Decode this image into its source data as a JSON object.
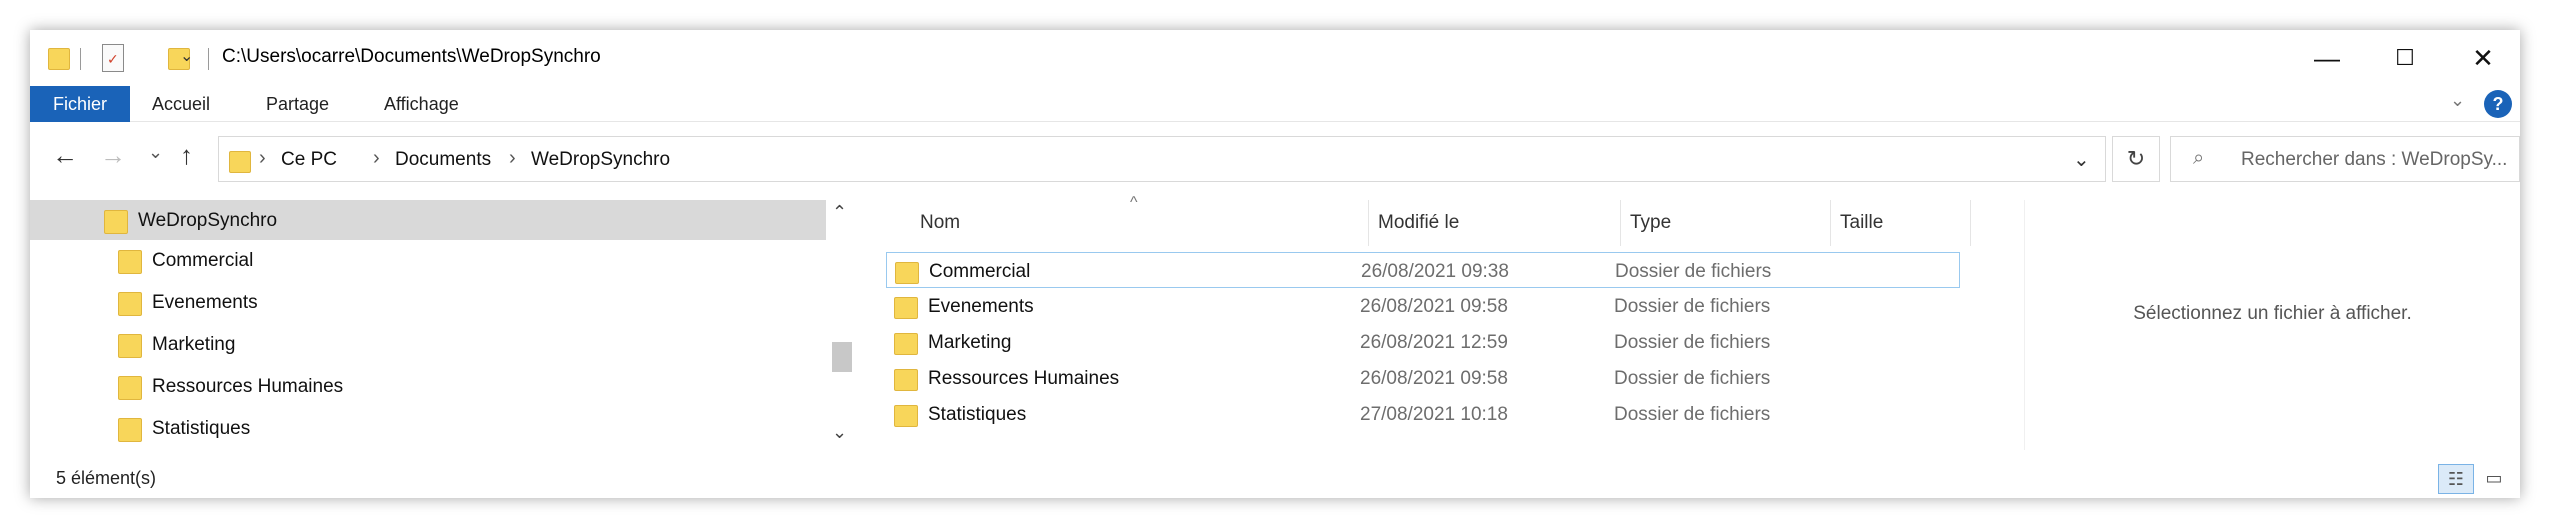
{
  "titlebar": {
    "path": "C:\\Users\\ocarre\\Documents\\WeDropSynchro",
    "icons": [
      "folder-icon",
      "properties-checkmark-icon",
      "new-folder-icon",
      "customize-dropdown-icon"
    ],
    "controls": {
      "minimize": "—",
      "maximize": "☐",
      "close": "✕"
    }
  },
  "ribbon": {
    "tabs": [
      {
        "label": "Fichier"
      },
      {
        "label": "Accueil"
      },
      {
        "label": "Partage"
      },
      {
        "label": "Affichage"
      }
    ],
    "accent": "#1a63b8",
    "expand": "⌄",
    "help": "?"
  },
  "nav": {
    "back": "←",
    "forward": "→",
    "recent": "⌄",
    "up": "↑",
    "crumb_sep": "›",
    "breadcrumb": [
      "Ce PC",
      "Documents",
      "WeDropSynchro"
    ],
    "dropdown": "⌄",
    "refresh": "↻",
    "search_icon": "⌕",
    "search_placeholder": "Rechercher dans : WeDropSy..."
  },
  "tree": {
    "items": [
      {
        "label": "WeDropSynchro",
        "selected": true
      },
      {
        "label": "Commercial"
      },
      {
        "label": "Evenements"
      },
      {
        "label": "Marketing"
      },
      {
        "label": "Ressources Humaines"
      },
      {
        "label": "Statistiques"
      }
    ],
    "scroll_up": "⌃",
    "scroll_down": "⌄"
  },
  "files": {
    "columns": [
      "Nom",
      "Modifié le",
      "Type",
      "Taille"
    ],
    "sort_caret": "^",
    "rows": [
      {
        "name": "Commercial",
        "modified": "26/08/2021 09:38",
        "type": "Dossier de fichiers"
      },
      {
        "name": "Evenements",
        "modified": "26/08/2021 09:58",
        "type": "Dossier de fichiers"
      },
      {
        "name": "Marketing",
        "modified": "26/08/2021 12:59",
        "type": "Dossier de fichiers"
      },
      {
        "name": "Ressources Humaines",
        "modified": "26/08/2021 09:58",
        "type": "Dossier de fichiers"
      },
      {
        "name": "Statistiques",
        "modified": "27/08/2021 10:18",
        "type": "Dossier de fichiers"
      }
    ]
  },
  "preview": {
    "message": "Sélectionnez un fichier à afficher."
  },
  "status": {
    "count": "5 élément(s)",
    "view_details": "☷",
    "view_tiles": "▭"
  }
}
